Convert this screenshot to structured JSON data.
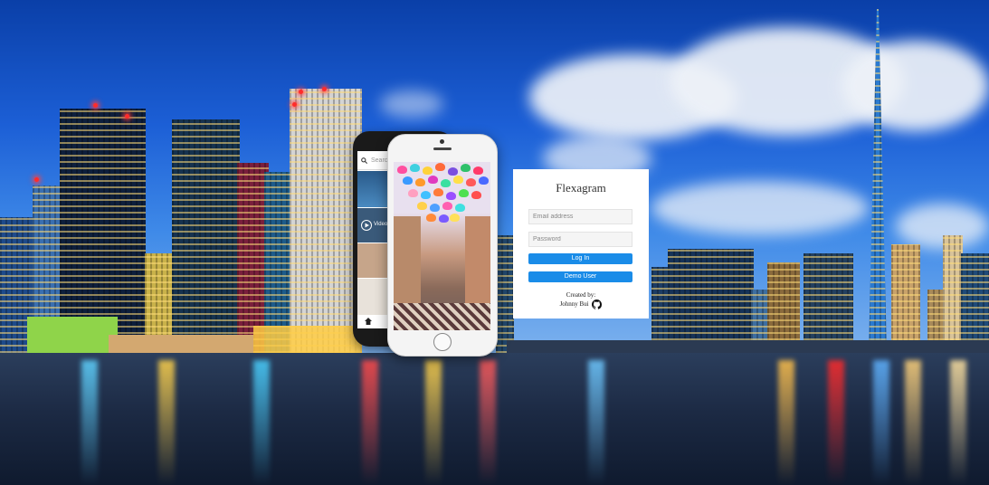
{
  "login": {
    "title": "Flexagram",
    "email_placeholder": "Email address",
    "password_placeholder": "Password",
    "login_label": "Log In",
    "demo_label": "Demo User",
    "created_by_label": "Created by:",
    "author_name": "Johnny Bui",
    "author_link_icon": "github-icon"
  },
  "phone_preview": {
    "search_placeholder": "Search",
    "video_label": "Video"
  },
  "colors": {
    "button": "#1a8ce8",
    "card_background": "#ffffff",
    "sky_top": "#0a3fa8"
  }
}
